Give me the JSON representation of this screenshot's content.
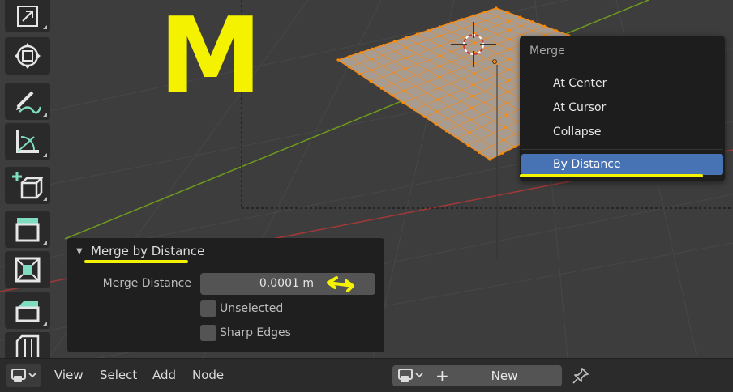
{
  "overlay_letter": "M",
  "merge_menu": {
    "title": "Merge",
    "items": [
      {
        "label": "At Center",
        "active": false
      },
      {
        "label": "At Cursor",
        "active": false
      },
      {
        "label": "Collapse",
        "active": false
      },
      {
        "label": "By Distance",
        "active": true
      }
    ]
  },
  "operator_panel": {
    "title": "Merge by Distance",
    "merge_distance_label": "Merge Distance",
    "merge_distance_value": "0.0001 m",
    "options": [
      {
        "label": "Unselected",
        "checked": false
      },
      {
        "label": "Sharp Edges",
        "checked": false
      }
    ]
  },
  "bottom_bar": {
    "menus": [
      "View",
      "Select",
      "Add",
      "Node"
    ],
    "new_label": "New"
  },
  "colors": {
    "highlight_annotation": "#f5f200",
    "menu_active": "#4772b3",
    "mesh_vertex": "#ff8a00",
    "x_axis": "#a23838",
    "y_axis": "#6f9a1e"
  },
  "toolbar_icons": [
    "scale-icon",
    "transform-icon",
    "annotate-icon",
    "measure-icon",
    "add-cube-icon",
    "extrude-icon",
    "inset-icon",
    "bevel-icon",
    "loop-cut-icon"
  ]
}
